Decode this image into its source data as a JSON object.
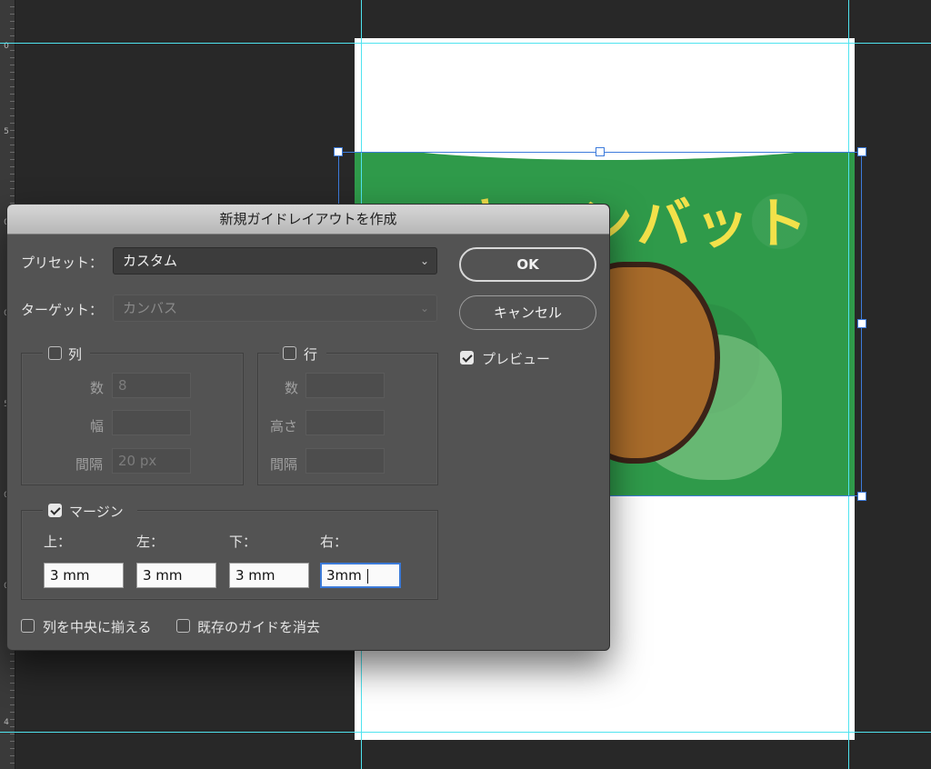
{
  "dialog": {
    "title": "新規ガイドレイアウトを作成",
    "preset_label": "プリセット：",
    "preset_value": "カスタム",
    "target_label": "ターゲット：",
    "target_value": "カンバス",
    "ok_label": "OK",
    "cancel_label": "キャンセル",
    "preview_label": "プレビュー",
    "preview_checked": true,
    "columns": {
      "label": "列",
      "checked": false,
      "count_label": "数",
      "count_value": "8",
      "width_label": "幅",
      "width_value": "",
      "gutter_label": "間隔",
      "gutter_value": "20 px"
    },
    "rows": {
      "label": "行",
      "checked": false,
      "count_label": "数",
      "count_value": "",
      "height_label": "高さ",
      "height_value": "",
      "gutter_label": "間隔",
      "gutter_value": ""
    },
    "margin": {
      "label": "マージン",
      "checked": true,
      "top_label": "上：",
      "top_value": "3 mm",
      "left_label": "左：",
      "left_value": "3 mm",
      "bottom_label": "下：",
      "bottom_value": "3 mm",
      "right_label": "右：",
      "right_value": "3mm"
    },
    "center_columns_label": "列を中央に揃える",
    "clear_guides_label": "既存のガイドを消去"
  },
  "canvas": {
    "artwork_text": "キャンバット",
    "ruler_labels": [
      "0",
      "5",
      "0",
      "0",
      "5",
      "0",
      "0",
      "4"
    ]
  },
  "colors": {
    "guide": "#4fe3ef",
    "selection": "#3d7bdc",
    "artwork_green": "#2f9a4a",
    "artwork_text": "#f2e14a",
    "dialog_bg": "#535353"
  }
}
